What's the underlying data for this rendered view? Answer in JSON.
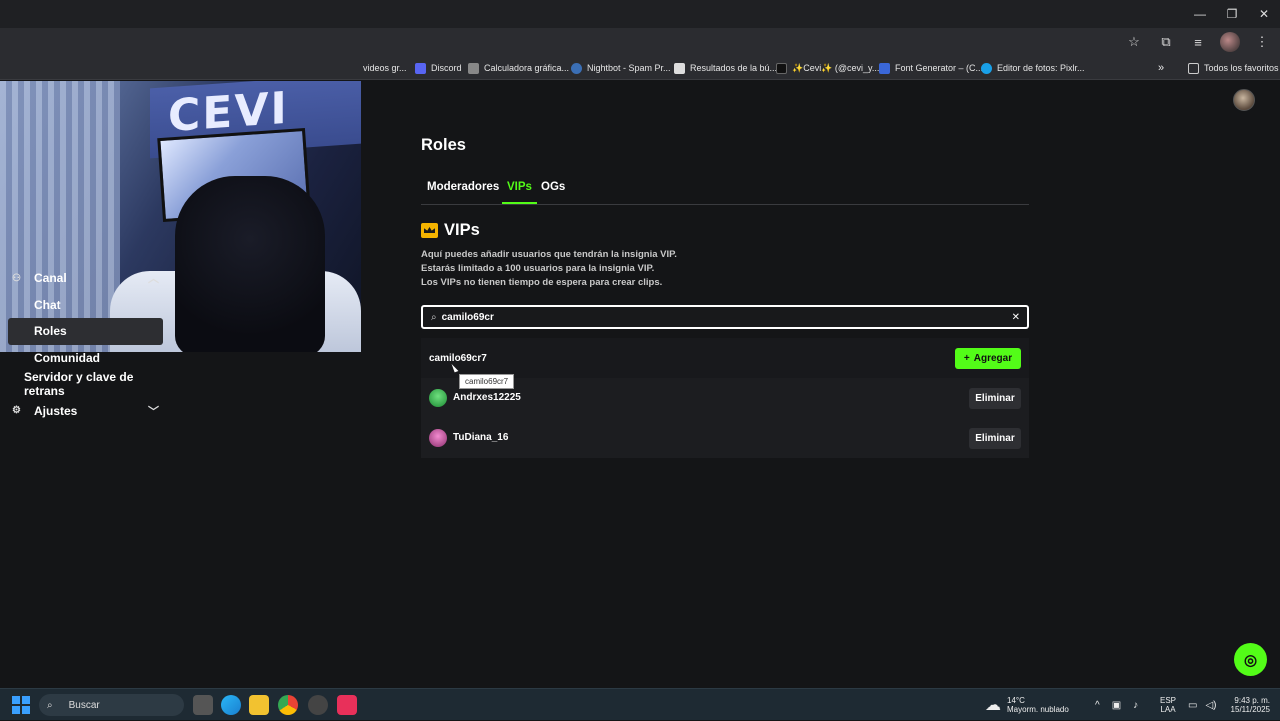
{
  "window": {
    "minimize": "—",
    "restore": "❐",
    "close": "✕"
  },
  "bookmarks": [
    {
      "label": "videos gr...",
      "color": "#c33"
    },
    {
      "label": "Discord",
      "color": "#5865f2"
    },
    {
      "label": "Calculadora gráfica...",
      "color": "#888"
    },
    {
      "label": "Nightbot - Spam Pr...",
      "color": "#3b6fb5"
    },
    {
      "label": "Resultados de la bú...",
      "color": "#ddd"
    },
    {
      "label": "✨Cevi✨ (@cevi_y...",
      "color": "#111"
    },
    {
      "label": "Font Generator – (C...",
      "color": "#3a67d8"
    },
    {
      "label": "Editor de fotos: Pixlr...",
      "color": "#19a0e8"
    }
  ],
  "bookmarks_more": "»",
  "all_favorites": "Todos los favoritos",
  "sidebar": {
    "canal": "Canal",
    "chat": "Chat",
    "roles": "Roles",
    "comunidad": "Comunidad",
    "servidor": "Servidor y clave de retrans",
    "ajustes": "Ajustes"
  },
  "main": {
    "title": "Roles",
    "tabs": [
      "Moderadores",
      "VIPs",
      "OGs"
    ],
    "section_title": "VIPs",
    "desc": [
      "Aquí puedes añadir usuarios que tendrán la insignia VIP.",
      "Estarás limitado a 100 usuarios para la insignia VIP.",
      "Los VIPs no tienen tiempo de espera para crear clips."
    ],
    "search_value": "camilo69cr",
    "search_result": "camilo69cr7",
    "add_label": "Agregar",
    "tooltip": "camilo69cr7",
    "vips": [
      {
        "name": "Andrxes12225",
        "avatar_color": "#2bbf4a"
      },
      {
        "name": "TuDiana_16",
        "avatar_color": "#d04fa0"
      }
    ],
    "remove_label": "Eliminar"
  },
  "taskbar": {
    "search_placeholder": "Buscar",
    "weather_temp": "14°C",
    "weather_desc": "Mayorm. nublado",
    "lang": "ESP",
    "lang_sub": "LAA",
    "time": "9:43 p. m.",
    "date": "15/11/2025"
  },
  "accent": "#53fc18"
}
